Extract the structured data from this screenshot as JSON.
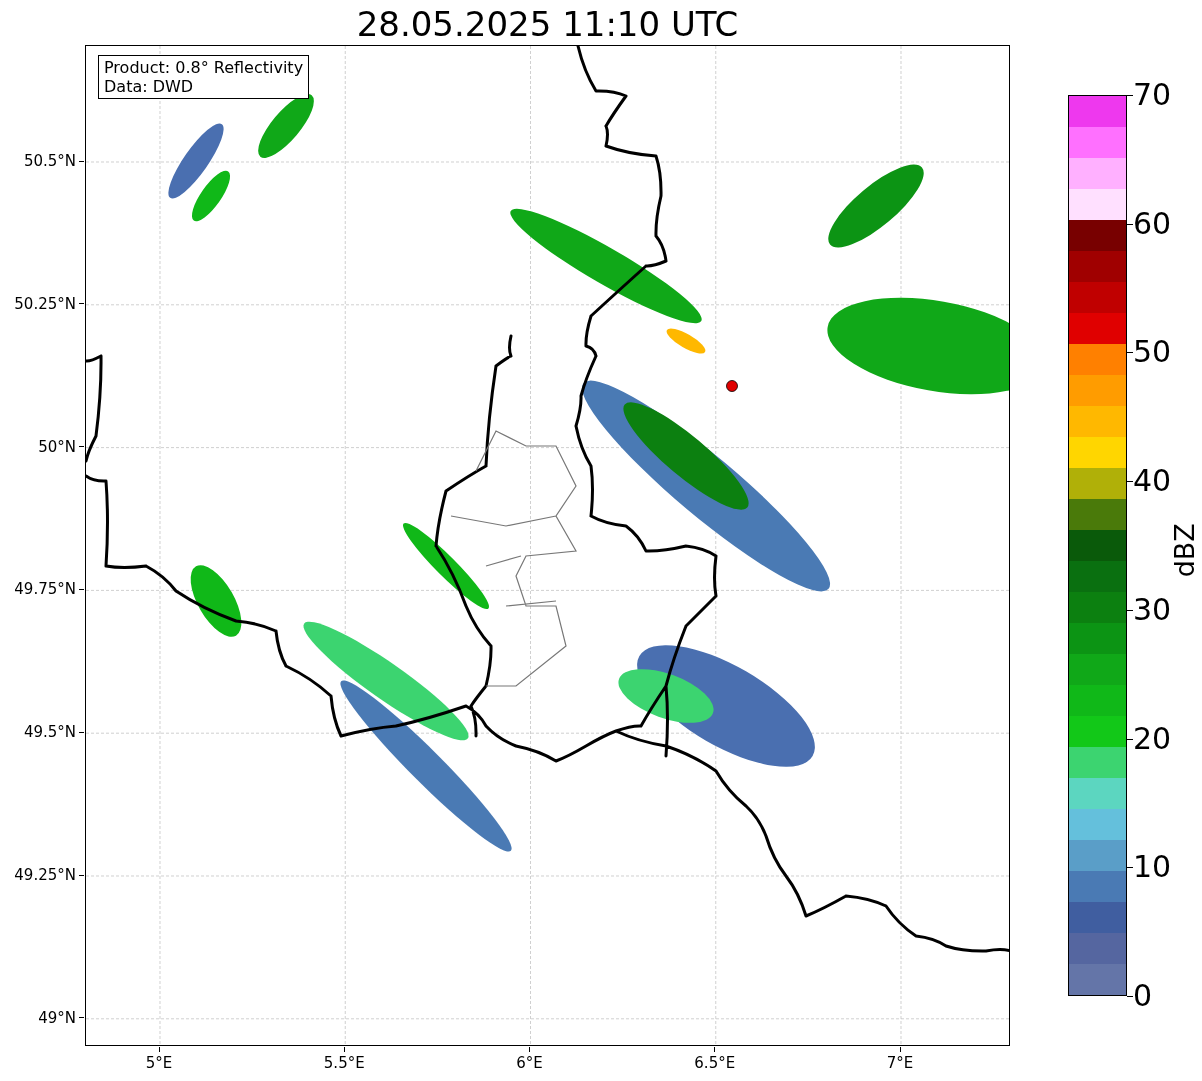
{
  "title": "28.05.2025 11:10 UTC",
  "info_box": {
    "lines": [
      "Product: 0.8° Reflectivity",
      "Data: DWD"
    ]
  },
  "map": {
    "y_tick_labels": [
      "50.5°N",
      "50.25°N",
      "50°N",
      "49.75°N",
      "49.5°N",
      "49.25°N",
      "49°N"
    ],
    "x_tick_labels": [
      "5°E",
      "5.5°E",
      "6°E",
      "6.5°E",
      "7°E"
    ]
  },
  "colorbar": {
    "label": "dBZ",
    "ticks": [
      "70",
      "60",
      "50",
      "40",
      "30",
      "20",
      "10",
      "0"
    ],
    "bins": [
      {
        "color": "#ee38ee"
      },
      {
        "color": "#ff70ff"
      },
      {
        "color": "#ffb0ff"
      },
      {
        "color": "#ffe0ff"
      },
      {
        "color": "#780000"
      },
      {
        "color": "#a00000"
      },
      {
        "color": "#c00000"
      },
      {
        "color": "#e00000"
      },
      {
        "color": "#ff8000"
      },
      {
        "color": "#ff9c00"
      },
      {
        "color": "#ffb800"
      },
      {
        "color": "#ffd600"
      },
      {
        "color": "#b0b008"
      },
      {
        "color": "#4a7a0a"
      },
      {
        "color": "#0a5a0a"
      },
      {
        "color": "#0a7010"
      },
      {
        "color": "#0c8010"
      },
      {
        "color": "#0c9414"
      },
      {
        "color": "#10a818"
      },
      {
        "color": "#10b818"
      },
      {
        "color": "#12c818"
      },
      {
        "color": "#3cd470"
      },
      {
        "color": "#5cd6c0"
      },
      {
        "color": "#64c0dc"
      },
      {
        "color": "#5a9ec8"
      },
      {
        "color": "#4a7ab4"
      },
      {
        "color": "#405ea0"
      },
      {
        "color": "#5566a0"
      },
      {
        "color": "#6475a8"
      }
    ]
  }
}
